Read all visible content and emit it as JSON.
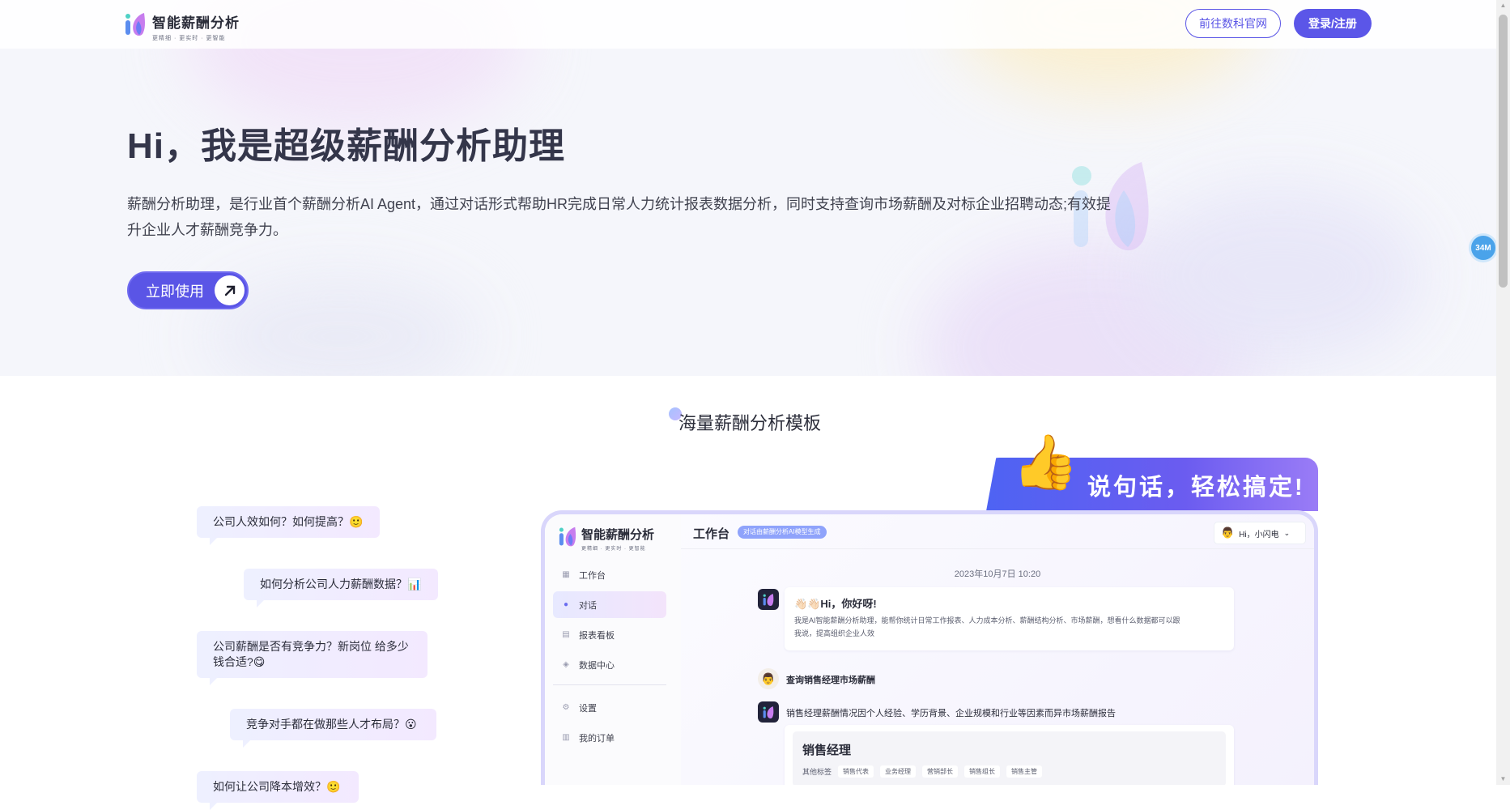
{
  "header": {
    "logo_title": "智能薪酬分析",
    "logo_subtitle": "更精细 · 更实时 · 更智能",
    "official_site_button": "前往数科官网",
    "login_button": "登录/注册"
  },
  "hero": {
    "title": "Hi，我是超级薪酬分析助理",
    "description": "薪酬分析助理，是行业首个薪酬分析AI Agent，通过对话形式帮助HR完成日常人力统计报表数据分析，同时支持查询市场薪酬及对标企业招聘动态;有效提升企业人才薪酬竞争力。",
    "cta_label": "立即使用"
  },
  "floating_badge": "34M",
  "templates": {
    "section_title": "海量薪酬分析模板",
    "questions": [
      "公司人效如何？如何提高？🙂",
      "如何分析公司人力薪酬数据？📊",
      "公司薪酬是否有竞争力？新岗位 给多少钱合适?😋",
      "竞争对手都在做那些人才布局？😮",
      "如何让公司降本增效？🙂"
    ],
    "banner_text": "说句话，轻松搞定!"
  },
  "mockup": {
    "logo_title": "智能薪酬分析",
    "logo_subtitle": "更精细 · 更实时 · 更智能",
    "nav": [
      "工作台",
      "对话",
      "报表看板",
      "数据中心",
      "设置",
      "我的订单"
    ],
    "header_title": "工作台",
    "header_badge": "对话由薪酬分析AI模型生成",
    "user_greeting": "Hi，小闪电",
    "timestamp": "2023年10月7日 10:20",
    "greeting_title": "👋🏻👋🏻Hi，你好呀!",
    "greeting_body": "我是AI智能薪酬分析助理，能帮你统计日常工作报表、人力成本分析、薪酬结构分析、市场薪酬，想看什么数据都可以跟我说，提高组织企业人效",
    "user_query": "查询销售经理市场薪酬",
    "ai_reply": "销售经理薪酬情况因个人经验、学历背景、企业规模和行业等因素而异市场薪酬报告",
    "job_title": "销售经理",
    "job_tags_label": "其他标签",
    "job_tags": [
      "销售代表",
      "业务经理",
      "营销部长",
      "销售组长",
      "销售主管"
    ]
  },
  "colors": {
    "primary": "#5b56e8",
    "float_badge": "#4aa3ea"
  }
}
